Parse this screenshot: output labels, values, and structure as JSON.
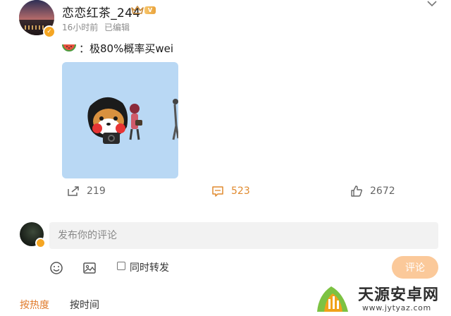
{
  "post": {
    "username": "恋恋红茶_244",
    "vip_label": "V",
    "timestamp": "16小时前",
    "edited_label": "已编辑",
    "text": "：极80%概率买wei"
  },
  "actions": {
    "repost_count": "219",
    "comment_count": "523",
    "like_count": "2672"
  },
  "composer": {
    "placeholder": "发布你的评论",
    "forward_label": "同时转发",
    "submit_label": "评论"
  },
  "sort": {
    "hot_label": "按热度",
    "time_label": "按时间"
  },
  "watermark": {
    "title": "天源安卓网",
    "url": "www.jytyaz.com"
  },
  "colors": {
    "accent": "#e07a2a",
    "image_bg": "#b9d8f4",
    "submit_bg": "#fbc99a"
  },
  "icons": [
    "more-icon",
    "crown-icon",
    "watermelon-icon",
    "repost-icon",
    "comment-icon",
    "like-icon",
    "emoji-icon",
    "image-icon"
  ]
}
